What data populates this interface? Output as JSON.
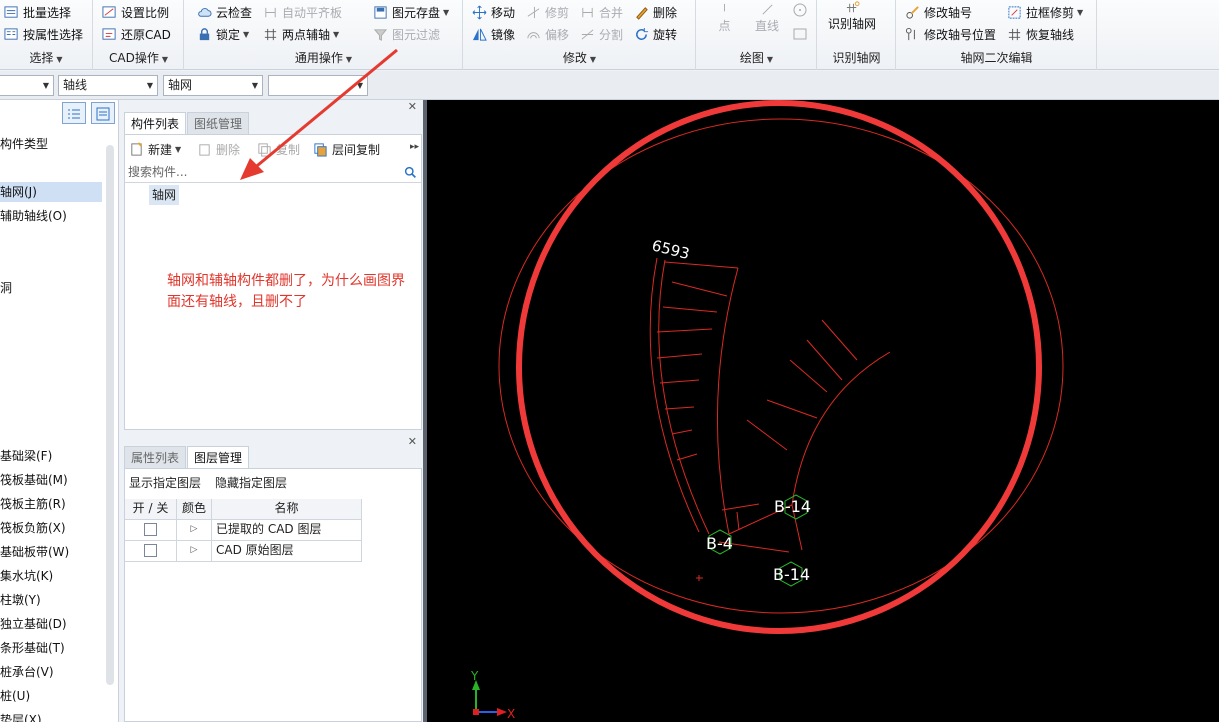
{
  "ribbon": {
    "select": {
      "title": "选择",
      "batch_select": "批量选择",
      "attr_select": "按属性选择"
    },
    "cad": {
      "title": "CAD操作",
      "set_scale": "设置比例",
      "restore_cad": "还原CAD"
    },
    "common": {
      "title": "通用操作",
      "cloud_check": "云检查",
      "auto_flat": "自动平齐板",
      "lock": "锁定",
      "two_point_axis": "两点辅轴",
      "save_element": "图元存盘",
      "element_filter": "图元过滤"
    },
    "modify": {
      "title": "修改",
      "move": "移动",
      "trim": "修剪",
      "merge": "合并",
      "delete": "删除",
      "mirror": "镜像",
      "offset": "偏移",
      "split": "分割",
      "rotate": "旋转"
    },
    "draw": {
      "title": "绘图",
      "point": "点",
      "line": "直线"
    },
    "recognize": {
      "title": "识别轴网",
      "recognize_grid": "识别轴网"
    },
    "secondary": {
      "title": "轴网二次编辑",
      "modify_axis_no": "修改轴号",
      "modify_axis_pos": "修改轴号位置",
      "box_trim": "拉框修剪",
      "restore_axis": "恢复轴线"
    }
  },
  "combos": {
    "c1": "",
    "c2": "轴线",
    "c3": "轴网",
    "c4": ""
  },
  "left_panel": {
    "items": [
      "构件类型",
      "轴网(J)",
      "辅助轴线(O)",
      "洞",
      "基础梁(F)",
      "筏板基础(M)",
      "筏板主筋(R)",
      "筏板负筋(X)",
      "基础板带(W)",
      "集水坑(K)",
      "柱墩(Y)",
      "独立基础(D)",
      "条形基础(T)",
      "桩承台(V)",
      "桩(U)",
      "垫层(X)"
    ]
  },
  "component_panel": {
    "tabs": [
      "构件列表",
      "图纸管理"
    ],
    "new": "新建",
    "delete": "删除",
    "copy": "复制",
    "floor_copy": "层间复制",
    "search_placeholder": "搜索构件...",
    "tree_item": "轴网",
    "annotation": "轴网和辅轴构件都删了，为什么画图界面还有轴线，且删不了"
  },
  "layer_panel": {
    "tabs": [
      "属性列表",
      "图层管理"
    ],
    "show_layer": "显示指定图层",
    "hide_layer": "隐藏指定图层",
    "col_toggle": "开 / 关",
    "col_color": "颜色",
    "col_name": "名称",
    "rows": [
      {
        "name": "已提取的 CAD 图层"
      },
      {
        "name": "CAD 原始图层"
      }
    ]
  },
  "canvas": {
    "labels": {
      "dim": "6593",
      "b14_top": "B-14",
      "b4": "B-4",
      "b14_bottom": "B-14",
      "axis_x": "X",
      "axis_y": "Y"
    },
    "colors": {
      "drawing_red": "#d92a22",
      "highlight_circle": "#f03a3a",
      "axis_node": "#27b327"
    }
  }
}
